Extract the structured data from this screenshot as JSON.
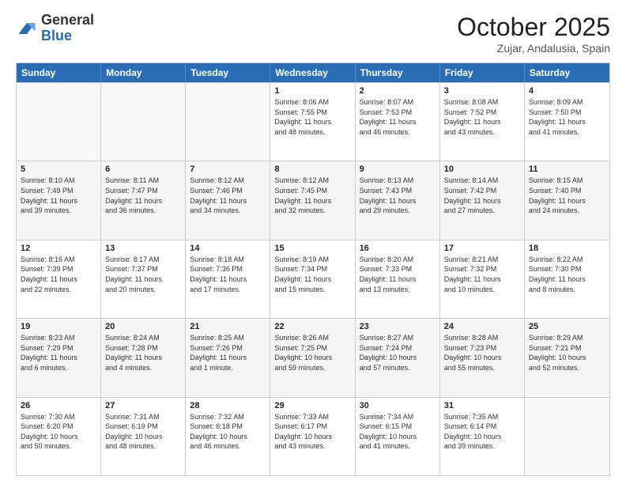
{
  "logo": {
    "general": "General",
    "blue": "Blue"
  },
  "title": "October 2025",
  "location": "Zujar, Andalusia, Spain",
  "days_of_week": [
    "Sunday",
    "Monday",
    "Tuesday",
    "Wednesday",
    "Thursday",
    "Friday",
    "Saturday"
  ],
  "weeks": [
    [
      {
        "day": "",
        "info": ""
      },
      {
        "day": "",
        "info": ""
      },
      {
        "day": "",
        "info": ""
      },
      {
        "day": "1",
        "info": "Sunrise: 8:06 AM\nSunset: 7:55 PM\nDaylight: 11 hours\nand 48 minutes."
      },
      {
        "day": "2",
        "info": "Sunrise: 8:07 AM\nSunset: 7:53 PM\nDaylight: 11 hours\nand 46 minutes."
      },
      {
        "day": "3",
        "info": "Sunrise: 8:08 AM\nSunset: 7:52 PM\nDaylight: 11 hours\nand 43 minutes."
      },
      {
        "day": "4",
        "info": "Sunrise: 8:09 AM\nSunset: 7:50 PM\nDaylight: 11 hours\nand 41 minutes."
      }
    ],
    [
      {
        "day": "5",
        "info": "Sunrise: 8:10 AM\nSunset: 7:49 PM\nDaylight: 11 hours\nand 39 minutes."
      },
      {
        "day": "6",
        "info": "Sunrise: 8:11 AM\nSunset: 7:47 PM\nDaylight: 11 hours\nand 36 minutes."
      },
      {
        "day": "7",
        "info": "Sunrise: 8:12 AM\nSunset: 7:46 PM\nDaylight: 11 hours\nand 34 minutes."
      },
      {
        "day": "8",
        "info": "Sunrise: 8:12 AM\nSunset: 7:45 PM\nDaylight: 11 hours\nand 32 minutes."
      },
      {
        "day": "9",
        "info": "Sunrise: 8:13 AM\nSunset: 7:43 PM\nDaylight: 11 hours\nand 29 minutes."
      },
      {
        "day": "10",
        "info": "Sunrise: 8:14 AM\nSunset: 7:42 PM\nDaylight: 11 hours\nand 27 minutes."
      },
      {
        "day": "11",
        "info": "Sunrise: 8:15 AM\nSunset: 7:40 PM\nDaylight: 11 hours\nand 24 minutes."
      }
    ],
    [
      {
        "day": "12",
        "info": "Sunrise: 8:16 AM\nSunset: 7:39 PM\nDaylight: 11 hours\nand 22 minutes."
      },
      {
        "day": "13",
        "info": "Sunrise: 8:17 AM\nSunset: 7:37 PM\nDaylight: 11 hours\nand 20 minutes."
      },
      {
        "day": "14",
        "info": "Sunrise: 8:18 AM\nSunset: 7:36 PM\nDaylight: 11 hours\nand 17 minutes."
      },
      {
        "day": "15",
        "info": "Sunrise: 8:19 AM\nSunset: 7:34 PM\nDaylight: 11 hours\nand 15 minutes."
      },
      {
        "day": "16",
        "info": "Sunrise: 8:20 AM\nSunset: 7:33 PM\nDaylight: 11 hours\nand 13 minutes."
      },
      {
        "day": "17",
        "info": "Sunrise: 8:21 AM\nSunset: 7:32 PM\nDaylight: 11 hours\nand 10 minutes."
      },
      {
        "day": "18",
        "info": "Sunrise: 8:22 AM\nSunset: 7:30 PM\nDaylight: 11 hours\nand 8 minutes."
      }
    ],
    [
      {
        "day": "19",
        "info": "Sunrise: 8:23 AM\nSunset: 7:29 PM\nDaylight: 11 hours\nand 6 minutes."
      },
      {
        "day": "20",
        "info": "Sunrise: 8:24 AM\nSunset: 7:28 PM\nDaylight: 11 hours\nand 4 minutes."
      },
      {
        "day": "21",
        "info": "Sunrise: 8:25 AM\nSunset: 7:26 PM\nDaylight: 11 hours\nand 1 minute."
      },
      {
        "day": "22",
        "info": "Sunrise: 8:26 AM\nSunset: 7:25 PM\nDaylight: 10 hours\nand 59 minutes."
      },
      {
        "day": "23",
        "info": "Sunrise: 8:27 AM\nSunset: 7:24 PM\nDaylight: 10 hours\nand 57 minutes."
      },
      {
        "day": "24",
        "info": "Sunrise: 8:28 AM\nSunset: 7:23 PM\nDaylight: 10 hours\nand 55 minutes."
      },
      {
        "day": "25",
        "info": "Sunrise: 8:29 AM\nSunset: 7:21 PM\nDaylight: 10 hours\nand 52 minutes."
      }
    ],
    [
      {
        "day": "26",
        "info": "Sunrise: 7:30 AM\nSunset: 6:20 PM\nDaylight: 10 hours\nand 50 minutes."
      },
      {
        "day": "27",
        "info": "Sunrise: 7:31 AM\nSunset: 6:19 PM\nDaylight: 10 hours\nand 48 minutes."
      },
      {
        "day": "28",
        "info": "Sunrise: 7:32 AM\nSunset: 6:18 PM\nDaylight: 10 hours\nand 46 minutes."
      },
      {
        "day": "29",
        "info": "Sunrise: 7:33 AM\nSunset: 6:17 PM\nDaylight: 10 hours\nand 43 minutes."
      },
      {
        "day": "30",
        "info": "Sunrise: 7:34 AM\nSunset: 6:15 PM\nDaylight: 10 hours\nand 41 minutes."
      },
      {
        "day": "31",
        "info": "Sunrise: 7:35 AM\nSunset: 6:14 PM\nDaylight: 10 hours\nand 39 minutes."
      },
      {
        "day": "",
        "info": ""
      }
    ]
  ]
}
